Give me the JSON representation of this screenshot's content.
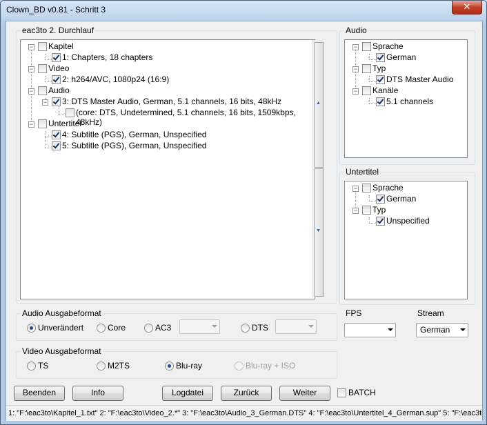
{
  "window": {
    "title": "Clown_BD v0.81 - Schritt 3",
    "close_symbol": "✕"
  },
  "tracks_group": {
    "title": "eac3to 2. Durchlauf",
    "items": [
      {
        "label": "Kapitel",
        "checked": false
      },
      {
        "label": "1: Chapters, 18 chapters",
        "checked": true
      },
      {
        "label": "Video",
        "checked": false
      },
      {
        "label": "2: h264/AVC, 1080p24 (16:9)",
        "checked": true
      },
      {
        "label": "Audio",
        "checked": false
      },
      {
        "label": "3: DTS Master Audio, German, 5.1 channels, 16 bits, 48kHz",
        "checked": true
      },
      {
        "label": "(core: DTS, Undetermined, 5.1 channels, 16 bits, 1509kbps, 48kHz)",
        "checked": false
      },
      {
        "label": "Untertitel",
        "checked": false
      },
      {
        "label": "4: Subtitle (PGS), German, Unspecified",
        "checked": true
      },
      {
        "label": "5: Subtitle (PGS), German, Unspecified",
        "checked": true
      }
    ]
  },
  "audio_group": {
    "title": "Audio",
    "items": [
      {
        "label": "Sprache",
        "checked": false
      },
      {
        "label": "German",
        "checked": true
      },
      {
        "label": "Typ",
        "checked": false
      },
      {
        "label": "DTS Master Audio",
        "checked": true
      },
      {
        "label": "Kanäle",
        "checked": false
      },
      {
        "label": "5.1 channels",
        "checked": true
      }
    ]
  },
  "subtitle_group": {
    "title": "Untertitel",
    "items": [
      {
        "label": "Sprache",
        "checked": false
      },
      {
        "label": "German",
        "checked": true
      },
      {
        "label": "Typ",
        "checked": false
      },
      {
        "label": "Unspecified",
        "checked": true
      }
    ]
  },
  "audio_format": {
    "title": "Audio Ausgabeformat",
    "options": [
      {
        "label": "Unverändert",
        "selected": true
      },
      {
        "label": "Core",
        "selected": false
      },
      {
        "label": "AC3",
        "selected": false
      },
      {
        "label": "DTS",
        "selected": false
      }
    ],
    "ac3_value": "",
    "dts_value": ""
  },
  "video_format": {
    "title": "Video Ausgabeformat",
    "options": [
      {
        "label": "TS",
        "selected": false
      },
      {
        "label": "M2TS",
        "selected": false
      },
      {
        "label": "Blu-ray",
        "selected": true
      },
      {
        "label": "Blu-ray + ISO",
        "selected": false,
        "disabled": true
      }
    ]
  },
  "fps": {
    "title": "FPS",
    "value": ""
  },
  "stream": {
    "title": "Stream",
    "value": "German"
  },
  "buttons": {
    "beenden": "Beenden",
    "info": "Info",
    "logdatei": "Logdatei",
    "zurueck": "Zurück",
    "weiter": "Weiter",
    "batch": "BATCH"
  },
  "status_text": "1: \"F:\\eac3to\\Kapitel_1.txt\" 2: \"F:\\eac3to\\Video_2.*\" 3: \"F:\\eac3to\\Audio_3_German.DTS\" 4: \"F:\\eac3to\\Untertitel_4_German.sup\" 5: \"F:\\eac3to\\U",
  "colors": {
    "selected_radio": "#1e4b8c",
    "window_frame": "#b9d1ea"
  }
}
